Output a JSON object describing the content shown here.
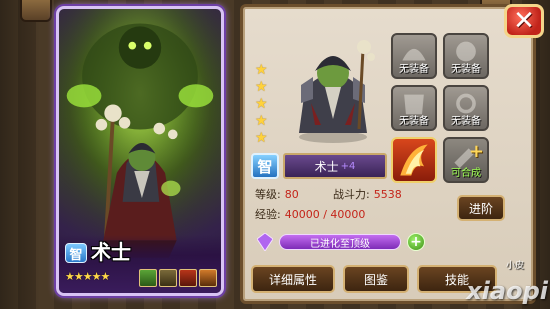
{
  "hero": {
    "name": "术士",
    "attribute_badge": "智",
    "star_count": 5,
    "stars_text": "★★★★★",
    "name_plate": "术士",
    "name_plus": "+4"
  },
  "equipment": {
    "slot_label_empty": "无装备",
    "synth_label": "可合成",
    "slots": [
      {
        "state": "empty",
        "label": "无装备"
      },
      {
        "state": "empty",
        "label": "无装备"
      },
      {
        "state": "empty",
        "label": "无装备"
      },
      {
        "state": "empty",
        "label": "无装备"
      },
      {
        "state": "equipped",
        "label": ""
      },
      {
        "state": "synthesizable",
        "label": "可合成"
      }
    ]
  },
  "stats": {
    "level_label": "等级:",
    "level_value": "80",
    "power_label": "战斗力:",
    "power_value": "5538",
    "exp_label": "经验:",
    "exp_value": "40000 / 40000"
  },
  "buttons": {
    "advance": "进阶",
    "close": "✕",
    "details": "详细属性",
    "gallery": "图鉴",
    "skills": "技能"
  },
  "evolve": {
    "label": "已进化至顶级"
  },
  "watermark": {
    "brand": "xiaopi",
    "small": "小皮"
  },
  "colors": {
    "card_border": "#d8c3f4",
    "panel_bg": "#e6dccd",
    "stat_value": "#c4251a",
    "evolve_bar": "#c46ef0"
  }
}
